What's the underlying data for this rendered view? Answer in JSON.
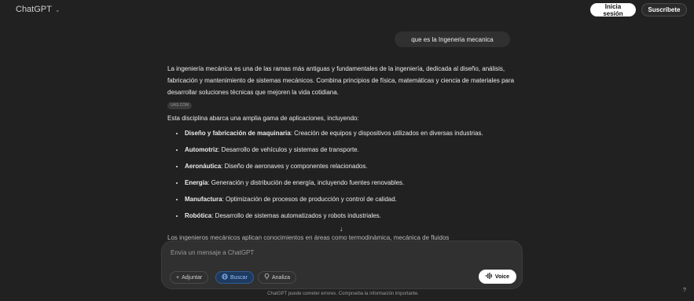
{
  "header": {
    "brand": "ChatGPT",
    "login_label": "Inicia sesión",
    "subscribe_label": "Suscríbete"
  },
  "conversation": {
    "user_message": "que es la Ingeneria mecanica",
    "answer": {
      "intro": "La ingeniería mecánica es una de las ramas más antiguas y fundamentales de la ingeniería, dedicada al diseño, análisis, fabricación y mantenimiento de sistemas mecánicos. Combina principios de física, matemáticas y ciencia de materiales para desarrollar soluciones técnicas que mejoren la vida cotidiana.",
      "source_badge": "UAS.COM",
      "lead": "Esta disciplina abarca una amplia gama de aplicaciones, incluyendo:",
      "items": [
        {
          "term": "Diseño y fabricación de maquinaria",
          "desc": ": Creación de equipos y dispositivos utilizados en diversas industrias."
        },
        {
          "term": "Automotriz",
          "desc": ": Desarrollo de vehículos y sistemas de transporte."
        },
        {
          "term": "Aeronáutica",
          "desc": ": Diseño de aeronaves y componentes relacionados."
        },
        {
          "term": "Energía",
          "desc": ": Generación y distribución de energía, incluyendo fuentes renovables."
        },
        {
          "term": "Manufactura",
          "desc": ": Optimización de procesos de producción y control de calidad."
        },
        {
          "term": "Robótica",
          "desc": ": Desarrollo de sistemas automatizados y robots industriales."
        }
      ],
      "cut_off_line": "Los ingenieros mecánicos aplican conocimientos en áreas como termodinámica, mecánica de fluidos"
    }
  },
  "composer": {
    "placeholder": "Envía un mensaje a ChatGPT",
    "attach_label": "Adjuntar",
    "search_label": "Buscar",
    "analyze_label": "Analiza",
    "voice_label": "Voice"
  },
  "footer": {
    "disclaimer": "ChatGPT puede cometer errores. Comprueba la información importante.",
    "help": "?"
  },
  "icons": {
    "brand_chevron": "chevron-down-icon",
    "scroll": "arrow-down-icon",
    "attach": "plus-icon",
    "search": "globe-icon",
    "analyze": "lightbulb-icon",
    "voice": "waveform-icon"
  },
  "colors": {
    "background": "#212121",
    "composer": "#303030",
    "search_active": "#8fc1ff"
  }
}
